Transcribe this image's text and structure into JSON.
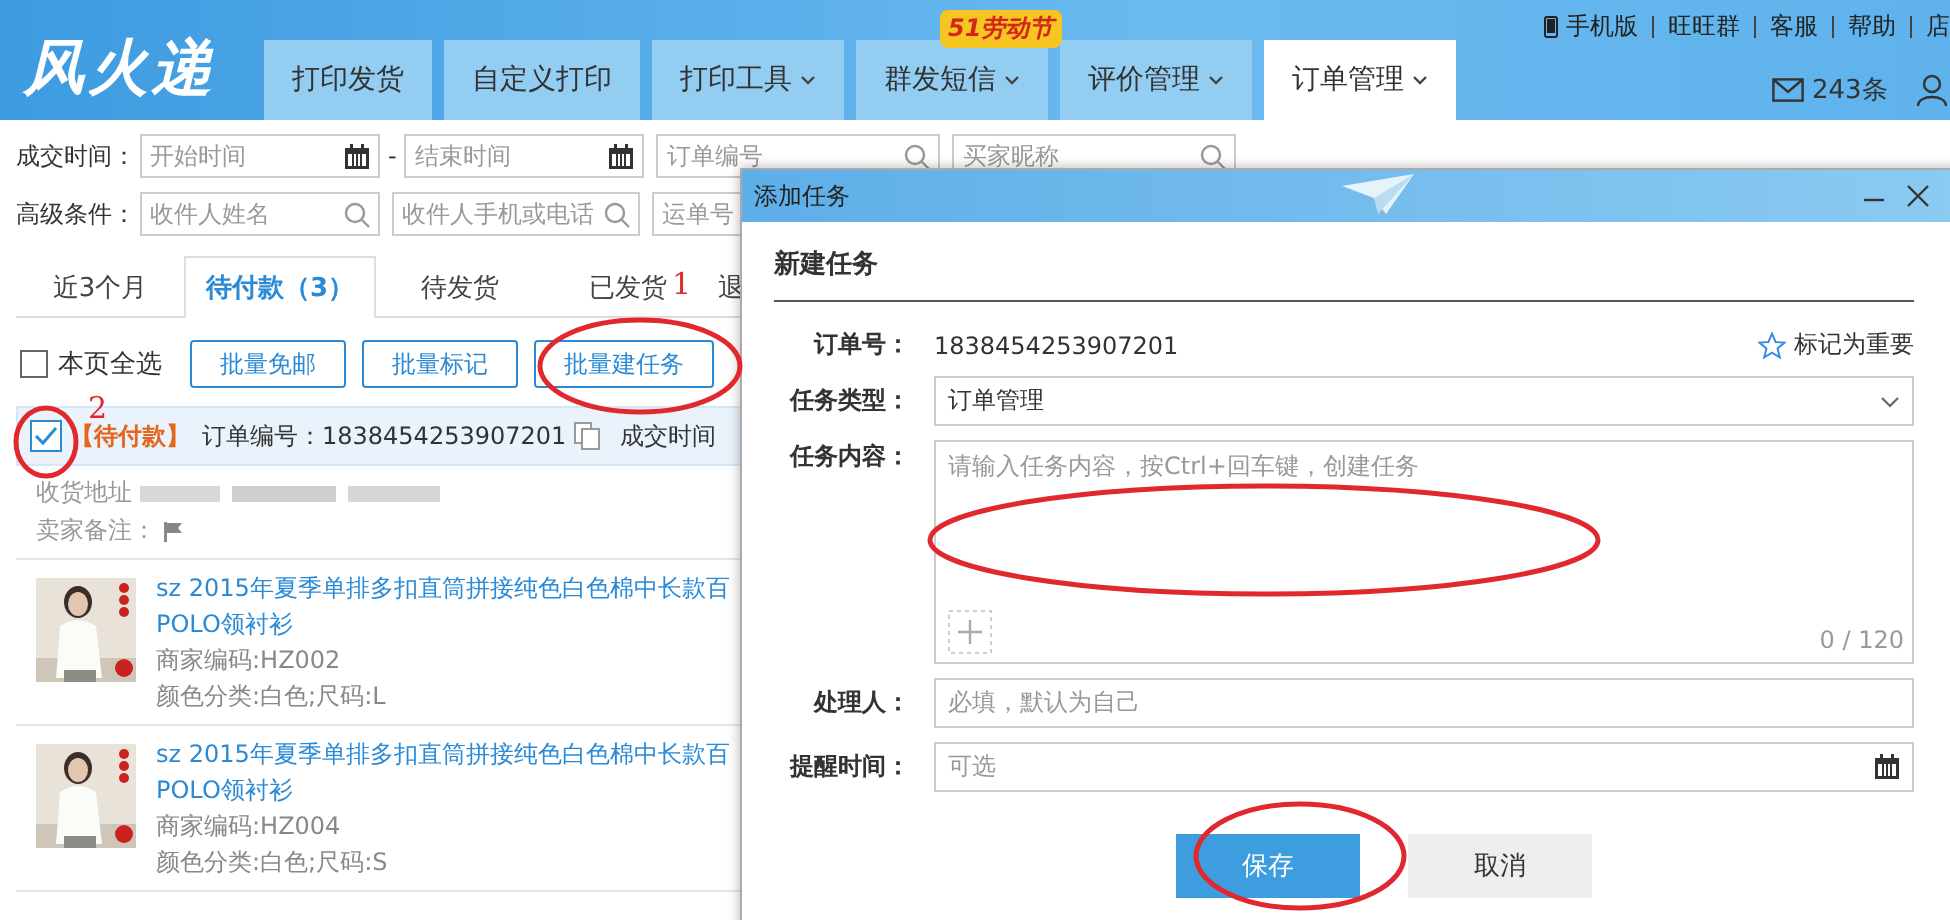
{
  "header": {
    "logo": "风火递",
    "promo_badge": "51劳动节",
    "nav_tabs": [
      {
        "label": "打印发货",
        "dropdown": false,
        "selected": false
      },
      {
        "label": "自定义打印",
        "dropdown": false,
        "selected": false
      },
      {
        "label": "打印工具",
        "dropdown": true,
        "selected": false
      },
      {
        "label": "群发短信",
        "dropdown": true,
        "selected": false
      },
      {
        "label": "评价管理",
        "dropdown": true,
        "selected": false
      },
      {
        "label": "订单管理",
        "dropdown": true,
        "selected": true
      }
    ],
    "top_links": [
      "手机版",
      "旺旺群",
      "客服",
      "帮助",
      "店"
    ],
    "messages": "243条"
  },
  "filters": [
    {
      "label": "成交时间：",
      "fields": [
        {
          "kind": "date",
          "placeholder": "开始时间"
        },
        {
          "kind": "separator",
          "text": "-"
        },
        {
          "kind": "date",
          "placeholder": "结束时间"
        },
        {
          "kind": "search",
          "placeholder": "订单编号"
        },
        {
          "kind": "search",
          "placeholder": "买家昵称"
        }
      ]
    },
    {
      "label": "高级条件：",
      "fields": [
        {
          "kind": "search",
          "placeholder": "收件人姓名"
        },
        {
          "kind": "search",
          "placeholder": "收件人手机或电话"
        },
        {
          "kind": "search",
          "placeholder": "运单号"
        }
      ]
    }
  ],
  "order_tabs": [
    {
      "label": "近3个月",
      "selected": false
    },
    {
      "label": "待付款（3）",
      "selected": true
    },
    {
      "label": "待发货",
      "selected": false
    },
    {
      "label": "已发货",
      "selected": false
    },
    {
      "label": "退",
      "selected": false
    }
  ],
  "actions": {
    "select_all": {
      "label": "本页全选",
      "checked": false
    },
    "buttons": [
      "批量免邮",
      "批量标记",
      "批量建任务"
    ]
  },
  "order": {
    "checked": true,
    "status": "【待付款】",
    "order_no": "订单编号：1838454253907201",
    "deal_time": "成交时间",
    "address_label": "收货地址",
    "remark_label": "卖家备注：",
    "items": [
      {
        "title_lines": [
          "sz 2015年夏季单排多扣直筒拼接纯色白色棉中长款百",
          "POLO领衬衫"
        ],
        "sku": "商家编码:HZ002",
        "spec": "颜色分类:白色;尺码:L"
      },
      {
        "title_lines": [
          "sz 2015年夏季单排多扣直筒拼接纯色白色棉中长款百",
          "POLO领衬衫"
        ],
        "sku": "商家编码:HZ004",
        "spec": "颜色分类:白色;尺码:S"
      }
    ]
  },
  "dialog": {
    "title": "添加任务",
    "heading": "新建任务",
    "order_label": "订单号：",
    "order_no": "1838454253907201",
    "mark_important": "标记为重要",
    "important": false,
    "type_label": "任务类型：",
    "type_value": "订单管理",
    "content_label": "任务内容：",
    "content_placeholder": "请输入任务内容，按Ctrl+回车键，创建任务",
    "counter": "0 / 120",
    "assignee_label": "处理人：",
    "assignee_placeholder": "必填，默认为自己",
    "remind_label": "提醒时间：",
    "remind_placeholder": "可选",
    "save": "保存",
    "cancel": "取消"
  },
  "annotations": [
    "1",
    "2"
  ]
}
